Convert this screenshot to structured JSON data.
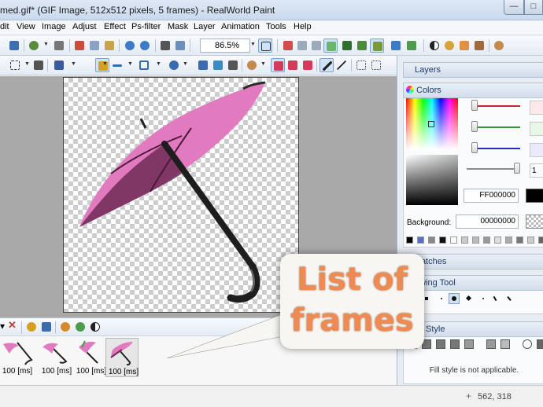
{
  "window": {
    "title": "med.gif* (GIF Image, 512x512 pixels, 5 frames) - RealWorld Paint",
    "minimize_icon": "minimize-icon",
    "maximize_icon": "maximize-icon"
  },
  "menu": {
    "items": [
      "dit",
      "View",
      "Image",
      "Adjust",
      "Effect",
      "Ps-filter",
      "Mask",
      "Layer",
      "Animation",
      "Tools",
      "Help"
    ]
  },
  "toolbar": {
    "zoom": "86.5%"
  },
  "frames": {
    "items": [
      {
        "label": "100 [ms]"
      },
      {
        "label": "100 [ms]"
      },
      {
        "label": "100 [ms]"
      },
      {
        "label": "100 [ms]",
        "selected": true
      }
    ]
  },
  "panels": {
    "layers": {
      "title": "Layers"
    },
    "colors": {
      "title": "Colors",
      "hex_value": "FF000000",
      "background_label": "Background:",
      "background_value": "00000000",
      "opacity_value": "1"
    },
    "swatches": {
      "title": "watches"
    },
    "drawing_tool": {
      "title": "awing Tool"
    },
    "fill_style": {
      "title": "Style",
      "message": "Fill style is not applicable."
    }
  },
  "status": {
    "coords": "562, 318"
  },
  "callout": {
    "line1": "List of",
    "line2": "frames"
  },
  "colors": {
    "accent": "#ef8a52",
    "umbrella": "#e57ac4",
    "selection": "#cfe3f8"
  }
}
